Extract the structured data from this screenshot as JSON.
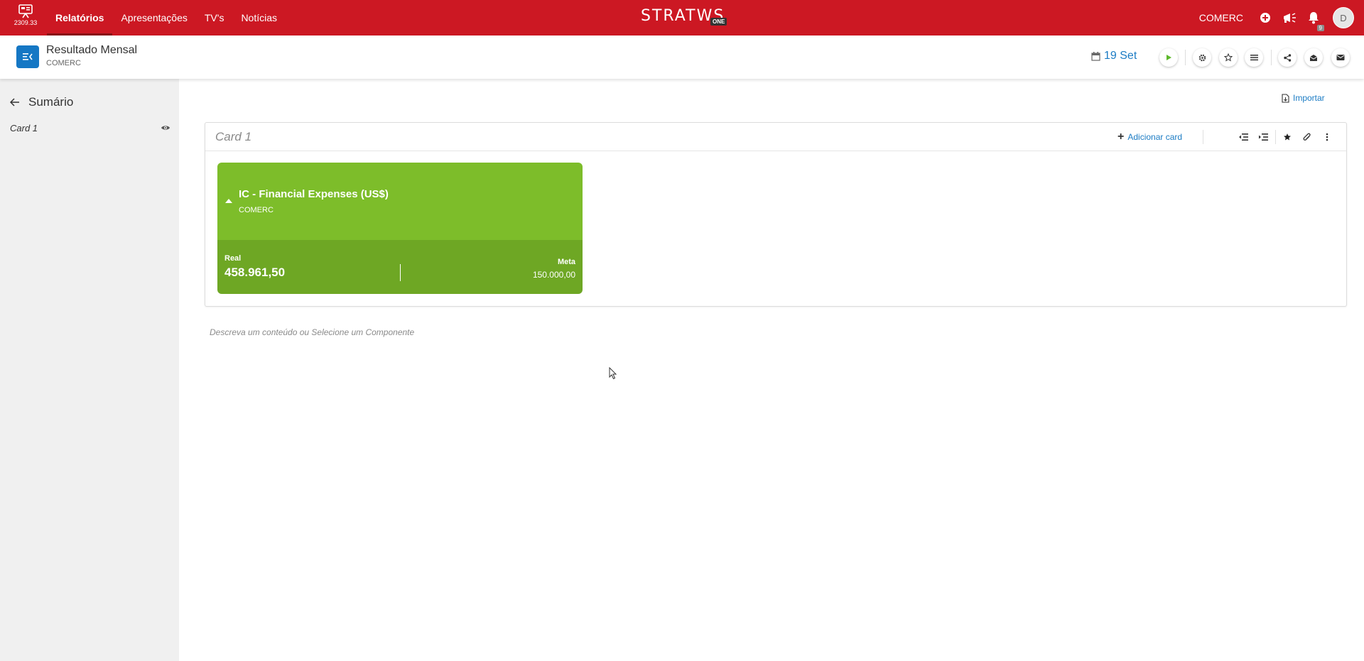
{
  "topbar": {
    "version": "2309.33",
    "nav": [
      {
        "label": "Relatórios",
        "active": true
      },
      {
        "label": "Apresentações",
        "active": false
      },
      {
        "label": "TV's",
        "active": false
      },
      {
        "label": "Notícias",
        "active": false
      }
    ],
    "brand_word": "STRATWS",
    "brand_badge": "ONE",
    "org": "COMERC",
    "notification_count": "9",
    "avatar_initial": "D",
    "bar_color": "#cc1823"
  },
  "subheader": {
    "title": "Resultado Mensal",
    "subtitle": "COMERC",
    "date": "19 Set"
  },
  "sidebar": {
    "title": "Sumário",
    "items": [
      {
        "label": "Card 1"
      }
    ]
  },
  "main": {
    "import_label": "Importar",
    "panel_title": "Card 1",
    "add_card_label": "Adicionar card",
    "hint": "Descreva um conteúdo ou Selecione um Componente"
  },
  "kpi": {
    "title": "IC - Financial Expenses (US$)",
    "org": "COMERC",
    "real_label": "Real",
    "real_value": "458.961,50",
    "meta_label": "Meta",
    "meta_value": "150.000,00",
    "color_top": "#7dbd2a",
    "color_bottom": "#6ea724"
  }
}
